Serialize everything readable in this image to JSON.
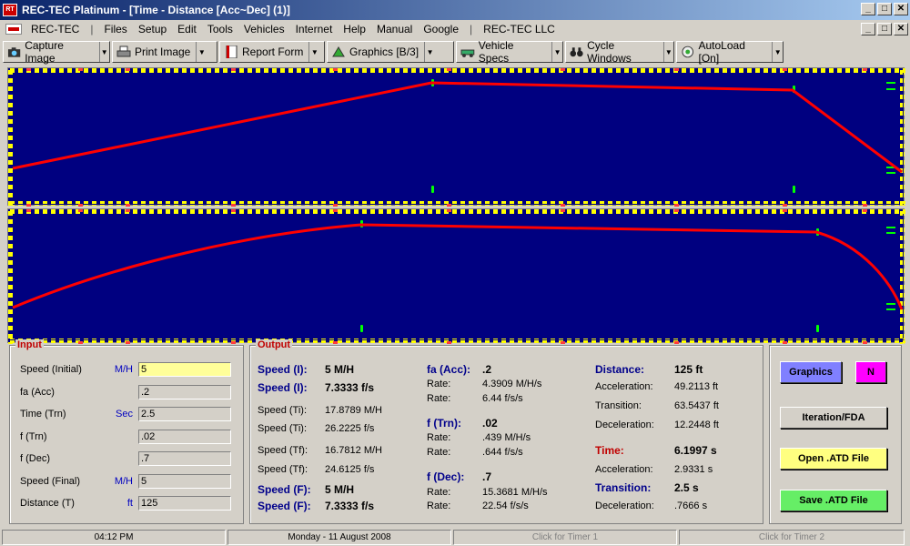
{
  "window": {
    "title": "REC-TEC Platinum - [Time - Distance [Acc~Dec] (1)]",
    "minimize": "_",
    "maximize": "□",
    "close": "✕"
  },
  "menu": {
    "items": [
      "REC-TEC",
      "|",
      "Files",
      "Setup",
      "Edit",
      "Tools",
      "Vehicles",
      "Internet",
      "Help",
      "Manual",
      "Google",
      "|",
      "REC-TEC LLC"
    ]
  },
  "toolbar": {
    "capture": "Capture Image",
    "print": "Print Image",
    "report": "Report Form",
    "graphics": "Graphics [B/3]",
    "vehicle": "Vehicle Specs",
    "cycle": "Cycle Windows",
    "autoload": "AutoLoad [On]"
  },
  "colors": {
    "plot_bg": "#000080",
    "curve": "#ff0000",
    "marker": "#00ff00",
    "tick": "#ffff00"
  },
  "input": {
    "title": "Input",
    "rows": [
      {
        "label": "Speed (Initial)",
        "unit": "M/H",
        "value": "5"
      },
      {
        "label": "fa (Acc)",
        "unit": "",
        "value": ".2"
      },
      {
        "label": "Time (Trn)",
        "unit": "Sec",
        "value": "2.5"
      },
      {
        "label": "f  (Trn)",
        "unit": "",
        "value": ".02"
      },
      {
        "label": "f  (Dec)",
        "unit": "",
        "value": ".7"
      },
      {
        "label": "Speed (Final)",
        "unit": "M/H",
        "value": "5"
      },
      {
        "label": "Distance (T)",
        "unit": "ft",
        "value": "125"
      }
    ]
  },
  "output": {
    "title": "Output",
    "col1": [
      {
        "label": "Speed (I):",
        "value": "5  M/H",
        "bold": true
      },
      {
        "label": "Speed (I):",
        "value": "7.3333  f/s",
        "bold": true
      },
      {
        "label": "Speed (Ti):",
        "value": "17.8789  M/H",
        "bold": false
      },
      {
        "label": "Speed (Ti):",
        "value": "26.2225  f/s",
        "bold": false
      },
      {
        "label": "Speed (Tf):",
        "value": "16.7812  M/H",
        "bold": false
      },
      {
        "label": "Speed (Tf):",
        "value": "24.6125  f/s",
        "bold": false
      },
      {
        "label": "Speed (F):",
        "value": "5  M/H",
        "bold": true
      },
      {
        "label": "Speed (F):",
        "value": "7.3333  f/s",
        "bold": true
      }
    ],
    "acc": {
      "label": "fa (Acc):",
      "value": ".2",
      "rate1_label": "Rate:",
      "rate1": "4.3909  M/H/s",
      "rate2_label": "Rate:",
      "rate2": "6.44  f/s/s"
    },
    "trn": {
      "label": "f (Trn):",
      "value": ".02",
      "rate1_label": "Rate:",
      "rate1": ".439  M/H/s",
      "rate2_label": "Rate:",
      "rate2": ".644  f/s/s"
    },
    "dec": {
      "label": "f (Dec):",
      "value": ".7",
      "rate1_label": "Rate:",
      "rate1": "15.3681  M/H/s",
      "rate2_label": "Rate:",
      "rate2": "22.54  f/s/s"
    },
    "distance": {
      "label": "Distance:",
      "value": "125  ft",
      "acc_label": "Acceleration:",
      "acc": "49.2113  ft",
      "trn_label": "Transition:",
      "trn": "63.5437  ft",
      "dec_label": "Deceleration:",
      "dec": "12.2448  ft"
    },
    "time": {
      "label": "Time:",
      "value": "6.1997  s",
      "acc_label": "Acceleration:",
      "acc": "2.9331  s",
      "trn_label": "Transition:",
      "trn": "2.5  s",
      "dec_label": "Deceleration:",
      "dec": ".7666  s"
    }
  },
  "buttons": {
    "graphics": "Graphics",
    "n": "N",
    "iteration": "Iteration/FDA",
    "open": "Open .ATD File",
    "save": "Save .ATD File"
  },
  "status": {
    "time": "04:12 PM",
    "date": "Monday  -  11 August 2008",
    "timer1": "Click for Timer 1",
    "timer2": "Click for Timer 2"
  }
}
